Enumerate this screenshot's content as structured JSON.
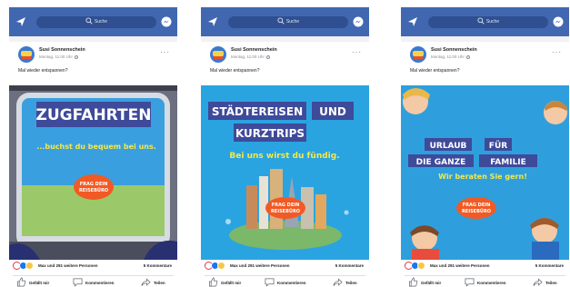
{
  "search_placeholder": "Suche",
  "post": {
    "author": "Susi Sonnenschein",
    "meta": "Montag, 11:00 Uhr",
    "text": "Mal wieder entspannen?",
    "reactions_text": "Max und 291 weitere Personen",
    "comments_count": "5 Kommentare",
    "actions": {
      "like": "Gefällt mir",
      "comment": "Kommentieren",
      "share": "Teilen"
    }
  },
  "ads": [
    {
      "headline": "ZUGFAHRTEN",
      "subline": "...buchst du bequem bei uns.",
      "cta": [
        "FRAG DEIN",
        "REISEBÜRO"
      ],
      "bg": "#2e8fd0"
    },
    {
      "headline": [
        "STÄDTEREISEN",
        "UND",
        "KURZTRIPS"
      ],
      "subline": "Bei uns wirst du fündig.",
      "cta": [
        "FRAG DEIN",
        "REISEBÜRO"
      ],
      "bg": "#2aa4e0"
    },
    {
      "headline": [
        "URLAUB",
        "FÜR",
        "DIE GANZE",
        "FAMILIE"
      ],
      "subline": "Wir beraten Sie gern!",
      "cta": [
        "FRAG DEIN",
        "REISEBÜRO"
      ],
      "bg": "#2e9fdc"
    }
  ],
  "colors": {
    "topbar": "#4167b0",
    "accent_orange": "#f15a24",
    "headline_bg": "#3e4a9a",
    "subline_yellow": "#f3e84a"
  }
}
